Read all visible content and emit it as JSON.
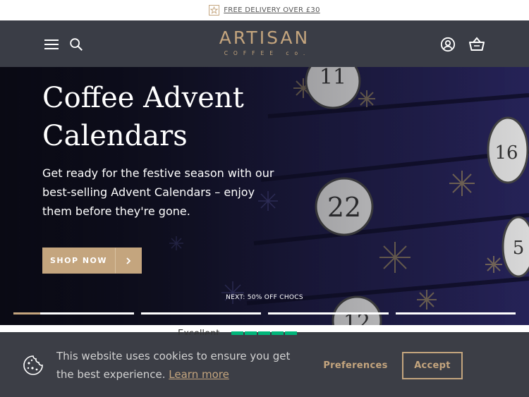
{
  "announcement": {
    "text": "FREE DELIVERY OVER £30",
    "icon": "star-icon"
  },
  "header": {
    "logo_name": "ARTISAN",
    "logo_sub": "COFFEE co.",
    "icons": [
      "menu-icon",
      "search-icon",
      "account-icon",
      "basket-icon"
    ]
  },
  "hero": {
    "title_line1": "Coffee Advent",
    "title_line2": "Calendars",
    "body": "Get ready for the festive season with our best-selling Advent Calendars – enjoy them before they're gone.",
    "cta_label": "SHOP NOW",
    "next_label": "NEXT: 50% OFF CHOCS",
    "slides_count": 4,
    "active_slide": 1,
    "active_progress": 0.22,
    "calendar_numbers": [
      "11",
      "22",
      "16",
      "5",
      "12"
    ]
  },
  "trust": {
    "text": "Excellent"
  },
  "cookie": {
    "message": "This website uses cookies to ensure you get the best experience.",
    "learn_more": "Learn more",
    "preferences_label": "Preferences",
    "accept_label": "Accept"
  },
  "colors": {
    "accent": "#c4a57e",
    "header_bg": "#3a3d46",
    "cookie_bg": "#3c3e46",
    "trustpilot": "#00b67a"
  }
}
